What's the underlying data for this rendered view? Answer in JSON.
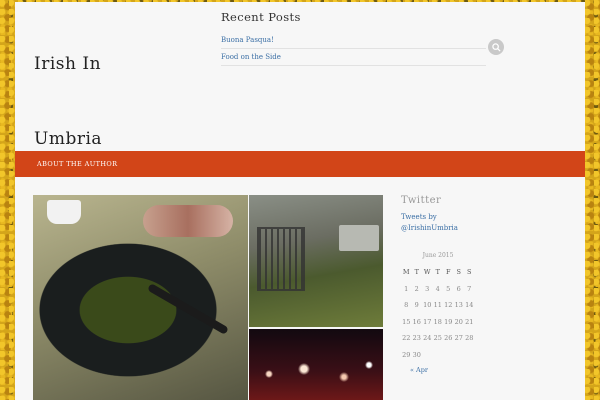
{
  "site": {
    "title_line1": "Irish In",
    "title_line2": "Umbria"
  },
  "recent_posts": {
    "title": "Recent Posts",
    "items": [
      "Buona Pasqua!",
      "Food on the Side"
    ]
  },
  "search": {
    "icon": "search-icon"
  },
  "nav": {
    "items": [
      "About the Author"
    ]
  },
  "twitter": {
    "title": "Twitter",
    "link_line1": "Tweets by",
    "link_line2": "@IrishinUmbria"
  },
  "calendar": {
    "caption": "June 2015",
    "weekdays": [
      "M",
      "T",
      "W",
      "T",
      "F",
      "S",
      "S"
    ],
    "weeks": [
      [
        "1",
        "2",
        "3",
        "4",
        "5",
        "6",
        "7"
      ],
      [
        "8",
        "9",
        "10",
        "11",
        "12",
        "13",
        "14"
      ],
      [
        "15",
        "16",
        "17",
        "18",
        "19",
        "20",
        "21"
      ],
      [
        "22",
        "23",
        "24",
        "25",
        "26",
        "27",
        "28"
      ],
      [
        "29",
        "30",
        "",
        "",
        "",
        "",
        ""
      ]
    ],
    "prev_link": "« Apr"
  },
  "colors": {
    "nav_background": "#d24518",
    "link": "#3b6fa5",
    "page_background": "#f7f7f7"
  }
}
